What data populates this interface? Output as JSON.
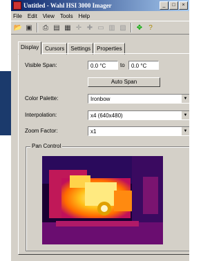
{
  "window": {
    "title": "Untitled - Wahl HSI 3000 Imager",
    "buttons": [
      "_",
      "□",
      "×"
    ]
  },
  "menu": [
    "File",
    "Edit",
    "View",
    "Tools",
    "Help"
  ],
  "toolbar": [
    "open-icon",
    "save-icon",
    "print-icon",
    "properties-icon",
    "image-icon",
    "crosshair-icon",
    "crosshair2-icon",
    "box-icon",
    "histogram-icon",
    "chart-icon",
    "pan-icon",
    "help-icon"
  ],
  "tabs": [
    "Display",
    "Cursors",
    "Settings",
    "Properties"
  ],
  "display": {
    "visible_span_label": "Visible Span:",
    "span_from": "0.0 °C",
    "span_to_label": "to",
    "span_to": "0.0 °C",
    "auto_span": "Auto Span",
    "color_palette_label": "Color Palette:",
    "color_palette": "Ironbow",
    "interpolation_label": "Interpolation:",
    "interpolation": "x4 (640x480)",
    "zoom_label": "Zoom Factor:",
    "zoom": "x1",
    "pan_label": "Pan Control"
  },
  "colors": {
    "title_start": "#0a246a",
    "title_end": "#a6caf0",
    "panel_blue": "#1b3a6c"
  }
}
